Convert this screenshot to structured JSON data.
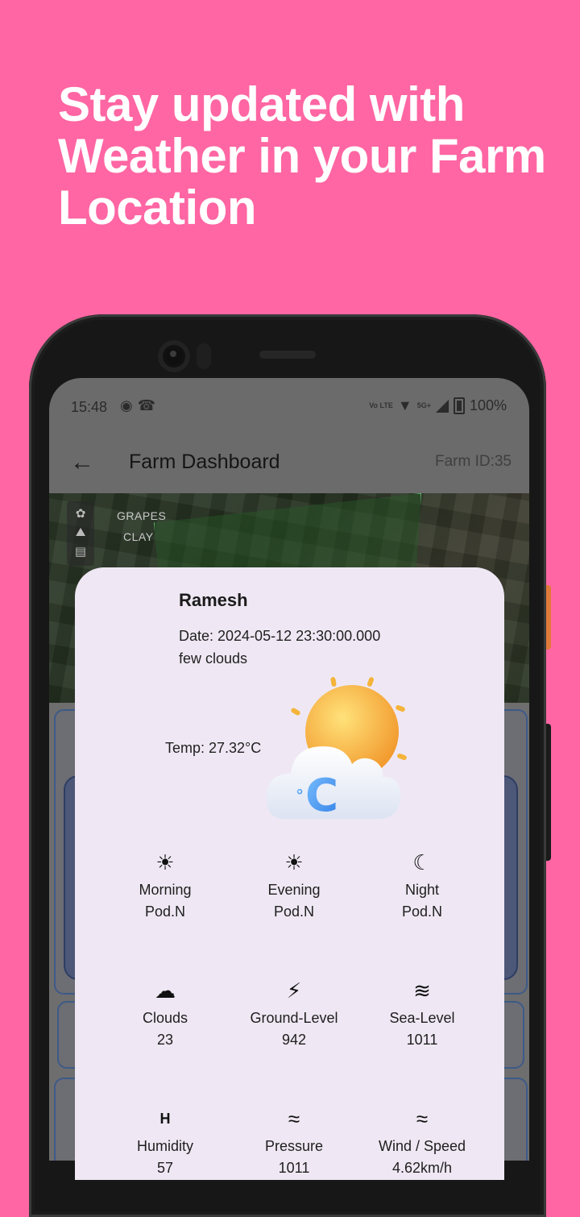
{
  "headline": [
    "Stay updated with",
    "Weather in your Farm",
    "Location"
  ],
  "status_bar": {
    "time": "15:48",
    "network": "Vo LTE",
    "five_g": "5G+",
    "battery": "100%"
  },
  "app_bar": {
    "title": "Farm Dashboard",
    "farm_id": "Farm ID:35"
  },
  "map_overlay": {
    "crop": "GRAPES",
    "soil": "CLAY"
  },
  "weather_dialog": {
    "name": "Ramesh",
    "date": "Date: 2024-05-12 23:30:00.000",
    "description": "few clouds",
    "temp": "Temp: 27.32°C",
    "items": [
      {
        "icon": "sun-icon",
        "label": "Morning",
        "value": "Pod.N"
      },
      {
        "icon": "sunset-icon",
        "label": "Evening",
        "value": "Pod.N"
      },
      {
        "icon": "moon-icon",
        "label": "Night",
        "value": "Pod.N"
      },
      {
        "icon": "cloud-icon",
        "label": "Clouds",
        "value": "23"
      },
      {
        "icon": "lightning-icon",
        "label": "Ground-Level",
        "value": "942"
      },
      {
        "icon": "waves-icon",
        "label": "Sea-Level",
        "value": "1011"
      },
      {
        "icon": "humidity-icon",
        "label": "Humidity",
        "value": "57"
      },
      {
        "icon": "wind-icon",
        "label": "Pressure",
        "value": "1011"
      },
      {
        "icon": "wind-icon",
        "label": "Wind / Speed",
        "value": "4.62km/h"
      }
    ]
  },
  "colors": {
    "background": "#FF66A3",
    "dialog": "#EFE8F4",
    "sun": "#F2B23A",
    "cloud": "#E9EEF8",
    "badge": "#3D8BEA"
  }
}
